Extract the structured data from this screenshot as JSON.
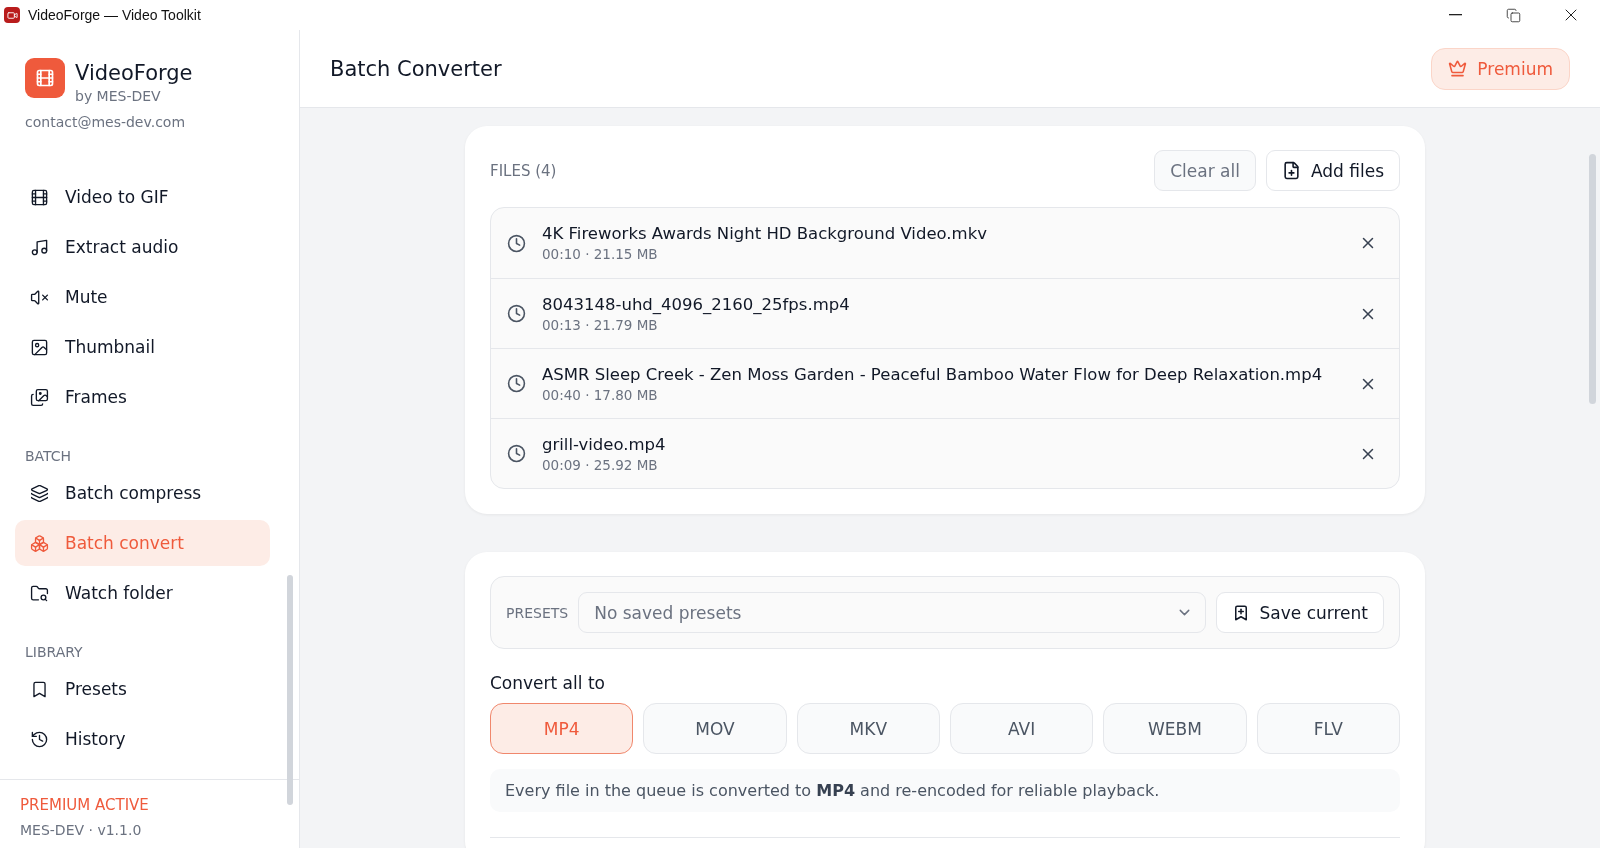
{
  "window": {
    "title": "VideoForge — Video Toolkit"
  },
  "brand": {
    "name": "VideoForge",
    "byline": "by MES-DEV",
    "contact": "contact@mes-dev.com"
  },
  "sidebar": {
    "sections": [
      {
        "items": [
          {
            "label": "Video to GIF",
            "selected": false
          },
          {
            "label": "Extract audio",
            "selected": false
          },
          {
            "label": "Mute",
            "selected": false
          },
          {
            "label": "Thumbnail",
            "selected": false
          },
          {
            "label": "Frames",
            "selected": false
          }
        ]
      },
      {
        "title": "BATCH",
        "items": [
          {
            "label": "Batch compress",
            "selected": false
          },
          {
            "label": "Batch convert",
            "selected": true
          },
          {
            "label": "Watch folder",
            "selected": false
          }
        ]
      },
      {
        "title": "LIBRARY",
        "items": [
          {
            "label": "Presets",
            "selected": false
          },
          {
            "label": "History",
            "selected": false
          }
        ]
      }
    ],
    "footer": {
      "status": "PREMIUM ACTIVE",
      "version": "MES-DEV · v1.1.0"
    }
  },
  "header": {
    "title": "Batch Converter",
    "premium_button": "Premium"
  },
  "files": {
    "heading": "FILES (4)",
    "clear_button": "Clear all",
    "add_button": "Add files",
    "items": [
      {
        "name": "4K Fireworks Awards Night HD Background Video.mkv",
        "meta": "00:10 · 21.15 MB"
      },
      {
        "name": "8043148-uhd_4096_2160_25fps.mp4",
        "meta": "00:13 · 21.79 MB"
      },
      {
        "name": "ASMR Sleep Creek - Zen Moss Garden - Peaceful Bamboo Water Flow for Deep Relaxation.mp4",
        "meta": "00:40 · 17.80 MB"
      },
      {
        "name": "grill-video.mp4",
        "meta": "00:09 · 25.92 MB"
      }
    ]
  },
  "presets": {
    "label": "PRESETS",
    "placeholder": "No saved presets",
    "save_button": "Save current"
  },
  "convert": {
    "label": "Convert all to",
    "formats": [
      {
        "label": "MP4",
        "selected": true
      },
      {
        "label": "MOV",
        "selected": false
      },
      {
        "label": "MKV",
        "selected": false
      },
      {
        "label": "AVI",
        "selected": false
      },
      {
        "label": "WEBM",
        "selected": false
      },
      {
        "label": "FLV",
        "selected": false
      }
    ],
    "note": "Every file in the queue is converted to **MP4** and re-encoded for reliable playback."
  }
}
